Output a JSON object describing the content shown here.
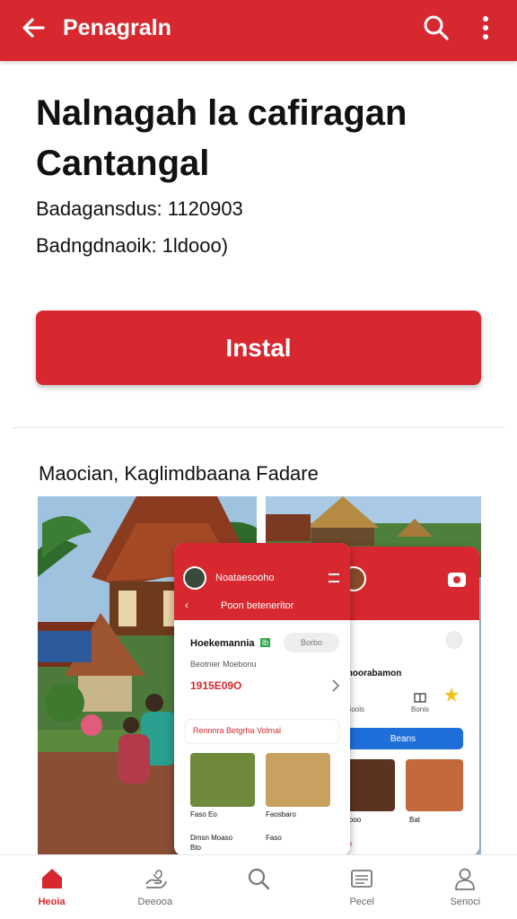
{
  "appbar": {
    "title": "Penagraln",
    "back_icon": "arrow-left-icon",
    "search_icon": "search-icon",
    "more_icon": "more-vertical-icon"
  },
  "app": {
    "title": "Nalnagah la cafiragan Cantangal",
    "meta_line_1": "Badagansdus: 1120903",
    "meta_line_2": "Badngdnaoik: 1ldooo)",
    "install_label": "Instal"
  },
  "screenshots": {
    "title": "Maocian, Kaglimdbaana Fadare",
    "phone1": {
      "header_name": "Noataesooho",
      "subheader": "Poon beteneritor",
      "card_title": "Hoekemannia",
      "card_badge": "lb",
      "search_chip": "Borbo",
      "card_subtitle": "Beotnier Moebonu",
      "card_value": "1915E09O",
      "promo": "Rennnra  Betgrha Volmal",
      "food1_label": "Faso Eo",
      "food2_label": "Faosbaro",
      "footer1_title": "Dmsn Moaso",
      "footer1_sub": "Bto",
      "footer2_title": "Faso"
    },
    "phone2": {
      "section_label": "lhoorabamon",
      "icon_label_1": "Bools",
      "icon_label_2": "Bonis",
      "button_label": "Beans",
      "food1_label": "Fooo",
      "food2_label": "Bat",
      "footer_label": "sm"
    }
  },
  "bottom_nav": [
    {
      "label": "Heoia",
      "icon": "home-icon",
      "active": true
    },
    {
      "label": "Deeooa",
      "icon": "hand-heart-icon",
      "active": false
    },
    {
      "label": "",
      "icon": "search-icon",
      "active": false
    },
    {
      "label": "Pecel",
      "icon": "list-icon",
      "active": false
    },
    {
      "label": "Senoci",
      "icon": "person-icon",
      "active": false
    }
  ],
  "colors": {
    "primary": "#d7282f",
    "text": "#111111",
    "blue_button": "#1e6fd9"
  }
}
